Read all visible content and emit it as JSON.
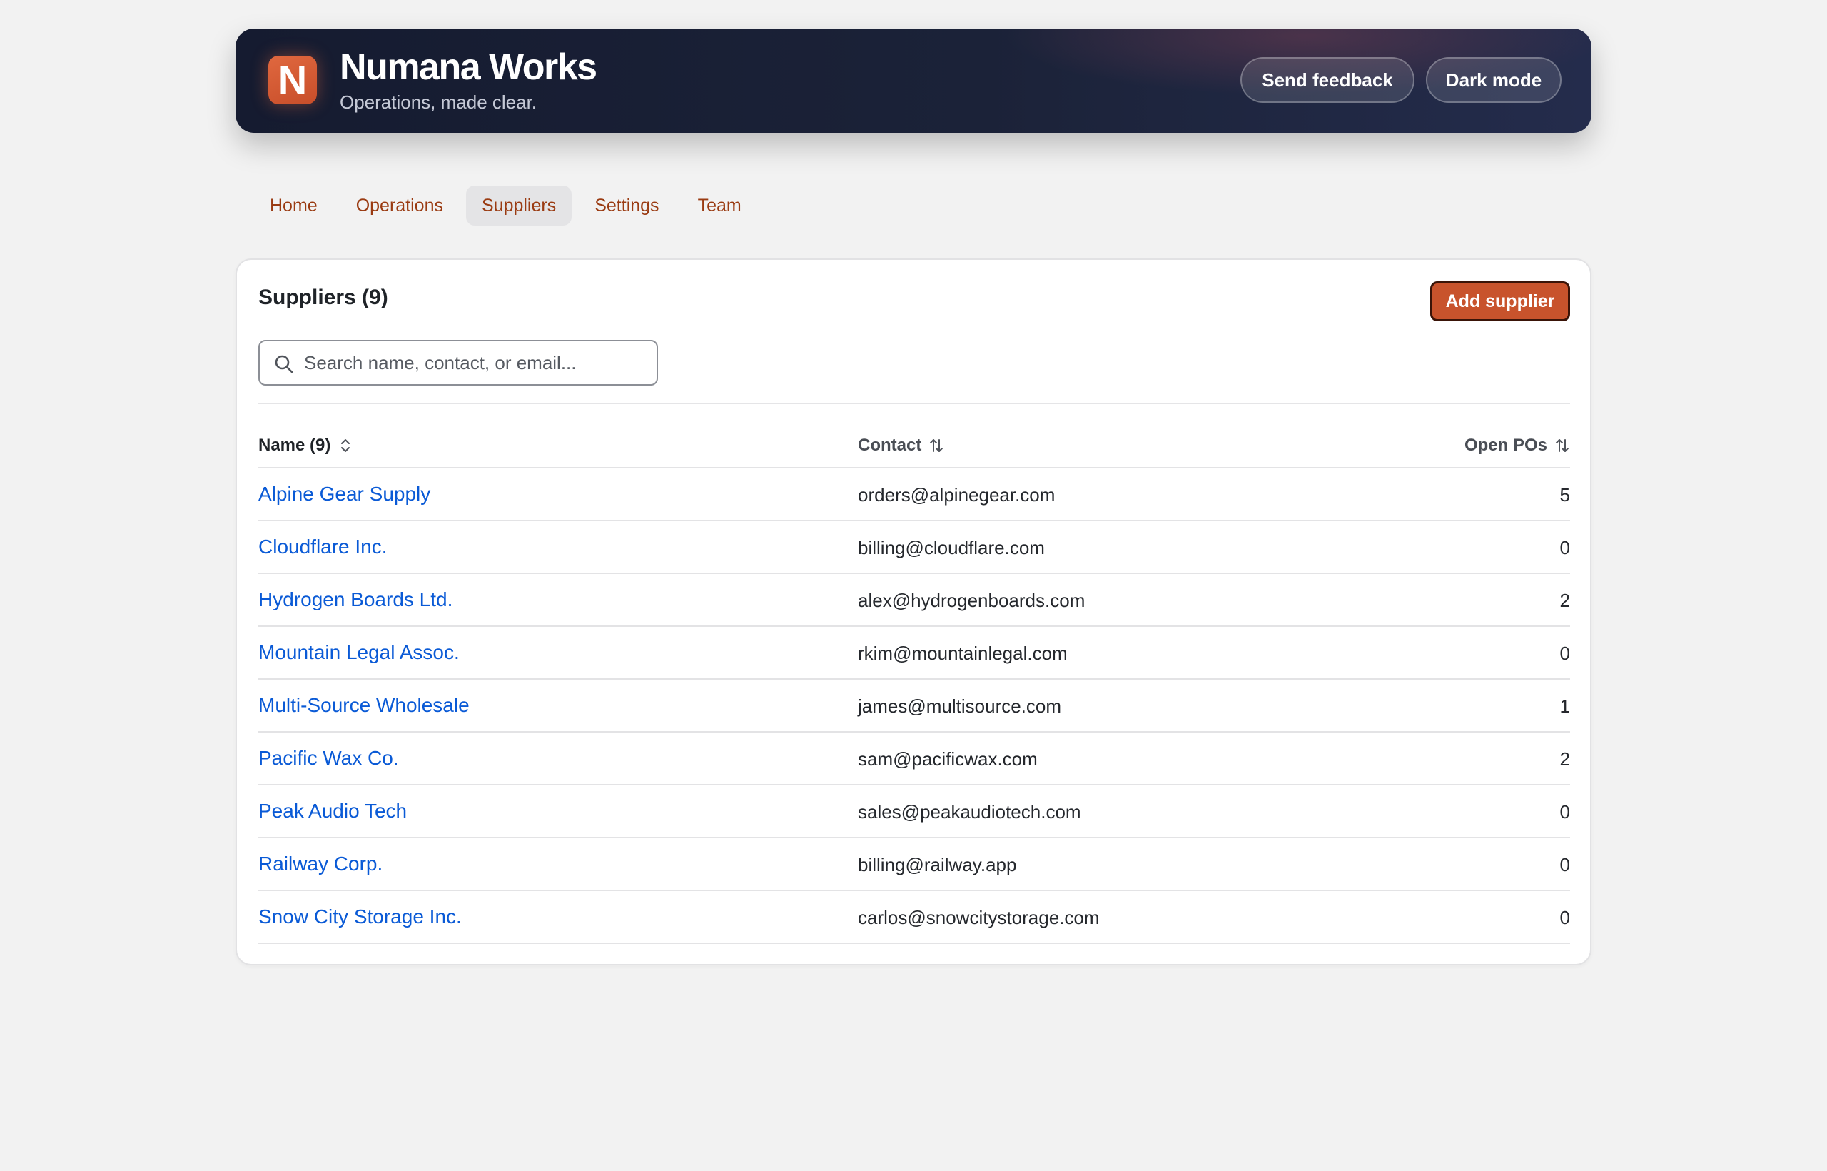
{
  "header": {
    "logo_letter": "N",
    "title": "Numana Works",
    "tagline": "Operations, made clear.",
    "feedback_label": "Send feedback",
    "dark_mode_label": "Dark mode"
  },
  "nav": {
    "items": [
      {
        "label": "Home"
      },
      {
        "label": "Operations"
      },
      {
        "label": "Suppliers"
      },
      {
        "label": "Settings"
      },
      {
        "label": "Team"
      }
    ],
    "active": "Suppliers"
  },
  "suppliers": {
    "title": "Suppliers (9)",
    "add_label": "Add supplier",
    "search_placeholder": "Search name, contact, or email...",
    "columns": {
      "name": "Name (9)",
      "contact": "Contact",
      "open_pos": "Open POs"
    },
    "rows": [
      {
        "name": "Alpine Gear Supply",
        "contact": "orders@alpinegear.com",
        "open_pos": "5"
      },
      {
        "name": "Cloudflare Inc.",
        "contact": "billing@cloudflare.com",
        "open_pos": "0"
      },
      {
        "name": "Hydrogen Boards Ltd.",
        "contact": "alex@hydrogenboards.com",
        "open_pos": "2"
      },
      {
        "name": "Mountain Legal Assoc.",
        "contact": "rkim@mountainlegal.com",
        "open_pos": "0"
      },
      {
        "name": "Multi-Source Wholesale",
        "contact": "james@multisource.com",
        "open_pos": "1"
      },
      {
        "name": "Pacific Wax Co.",
        "contact": "sam@pacificwax.com",
        "open_pos": "2"
      },
      {
        "name": "Peak Audio Tech",
        "contact": "sales@peakaudiotech.com",
        "open_pos": "0"
      },
      {
        "name": "Railway Corp.",
        "contact": "billing@railway.app",
        "open_pos": "0"
      },
      {
        "name": "Snow City Storage Inc.",
        "contact": "carlos@snowcitystorage.com",
        "open_pos": "0"
      }
    ]
  },
  "colors": {
    "accent": "#c8532c",
    "link": "#0a5ad6",
    "nav_text": "#9a3b12",
    "header_bg": "#1b2238"
  }
}
